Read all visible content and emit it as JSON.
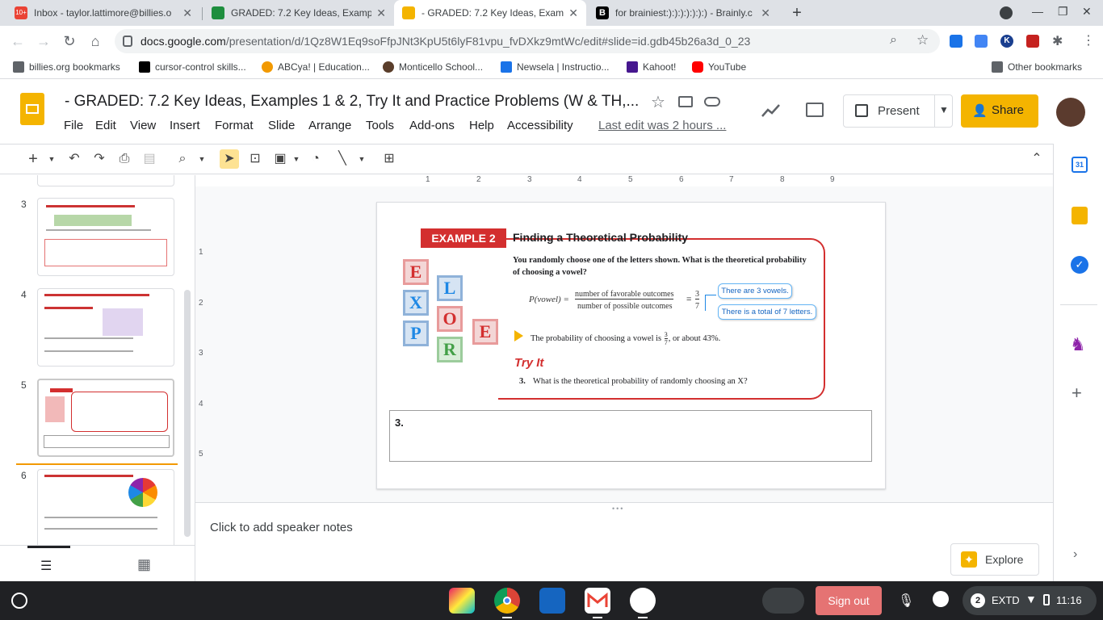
{
  "browser": {
    "tabs": [
      {
        "title": "Inbox - taylor.lattimore@billies.o",
        "badge": "10+"
      },
      {
        "title": "GRADED: 7.2 Key Ideas, Example"
      },
      {
        "title": "- GRADED: 7.2 Key Ideas, Examp"
      },
      {
        "title": "for brainiest:):):):):):):) - Brainly.c"
      }
    ],
    "url_host": "docs.google.com",
    "url_path": "/presentation/d/1Qz8W1Eq9soFfpJNt3KpU5t6lyF81vpu_fvDXkz9mtWc/edit#slide=id.gdb45b26a3d_0_23",
    "bookmarks": [
      "billies.org bookmarks",
      "cursor-control skills...",
      "ABCya! | Education...",
      "Monticello School...",
      "Newsela | Instructio...",
      "Kahoot!",
      "YouTube"
    ],
    "other_bookmarks": "Other bookmarks"
  },
  "app": {
    "title": "- GRADED: 7.2 Key Ideas, Examples 1 & 2, Try It and Practice Problems (W & TH,...",
    "menus": [
      "File",
      "Edit",
      "View",
      "Insert",
      "Format",
      "Slide",
      "Arrange",
      "Tools",
      "Add-ons",
      "Help",
      "Accessibility"
    ],
    "last_edit": "Last edit was 2 hours ...",
    "present_label": "Present",
    "share_label": "Share"
  },
  "filmstrip": {
    "slide_numbers": [
      "3",
      "4",
      "5",
      "6"
    ]
  },
  "ruler": {
    "h_ticks": [
      "1",
      "2",
      "3",
      "4",
      "5",
      "6",
      "7",
      "8",
      "9"
    ],
    "v_ticks": [
      "1",
      "2",
      "3",
      "4",
      "5"
    ]
  },
  "slide": {
    "example_badge": "EXAMPLE 2",
    "heading": "Finding a Theoretical Probability",
    "question": "You randomly choose one of the letters shown. What is the theoretical probability of choosing a vowel?",
    "formula_lhs": "P(vowel) =",
    "formula_num": "number of favorable outcomes",
    "formula_den": "number of possible outcomes",
    "frac_num": "3",
    "frac_den": "7",
    "callout1": "There are 3 vowels.",
    "callout2": "There is a total of 7 letters.",
    "result_text": "The probability of choosing a vowel is",
    "result_suffix": ", or about 43%.",
    "tryit": "Try It",
    "q_num": "3.",
    "q_text": "What is the theoretical probability of randomly choosing an X?",
    "answer_label": "3.",
    "blocks": [
      "E",
      "L",
      "X",
      "O",
      "E",
      "P",
      "R"
    ]
  },
  "notes": {
    "placeholder": "Click to add speaker notes"
  },
  "explore_label": "Explore",
  "shelf": {
    "signout": "Sign out",
    "notif_count": "2",
    "kbd": "EXTD",
    "time": "11:16"
  }
}
